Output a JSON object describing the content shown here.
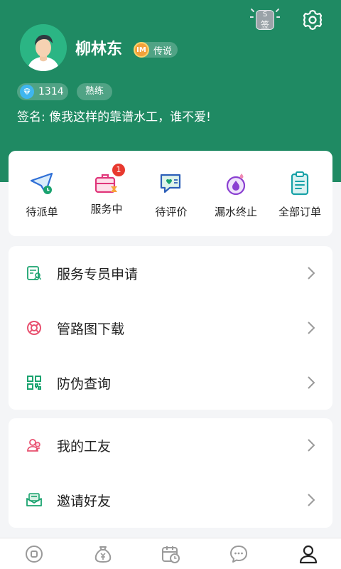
{
  "header": {
    "signin_label": "签",
    "signin_top": "S",
    "user_name": "柳林东",
    "level_icon_text": "IM",
    "level_label": "传说",
    "diamonds": "1314",
    "skill_tag": "熟练",
    "signature": "签名: 像我这样的靠谱水工，谁不爱!"
  },
  "orders": {
    "items": [
      {
        "label": "待派单",
        "icon": "paper-plane-clock-icon"
      },
      {
        "label": "服务中",
        "icon": "toolbox-hourglass-icon",
        "badge": "1"
      },
      {
        "label": "待评价",
        "icon": "chat-heart-icon"
      },
      {
        "label": "漏水终止",
        "icon": "water-drop-icon"
      },
      {
        "label": "全部订单",
        "icon": "clipboard-list-icon"
      }
    ]
  },
  "menu": {
    "group1": [
      {
        "label": "服务专员申请",
        "icon": "id-card-icon"
      },
      {
        "label": "管路图下载",
        "icon": "lifebuoy-icon"
      },
      {
        "label": "防伪查询",
        "icon": "qr-code-icon"
      }
    ],
    "group2": [
      {
        "label": "我的工友",
        "icon": "friends-icon"
      },
      {
        "label": "邀请好友",
        "icon": "invite-mail-icon"
      }
    ]
  },
  "tabs": [
    {
      "name": "home-tab",
      "icon": "home-circle-icon",
      "active": false
    },
    {
      "name": "earnings-tab",
      "icon": "money-bag-icon",
      "active": false
    },
    {
      "name": "schedule-tab",
      "icon": "calendar-clock-icon",
      "active": false
    },
    {
      "name": "messages-tab",
      "icon": "chat-bubble-icon",
      "active": false
    },
    {
      "name": "profile-tab",
      "icon": "person-icon",
      "active": true
    }
  ],
  "colors": {
    "header_green": "#1f8a63",
    "accent_green": "#1aa36f",
    "badge_red": "#e8392f"
  }
}
